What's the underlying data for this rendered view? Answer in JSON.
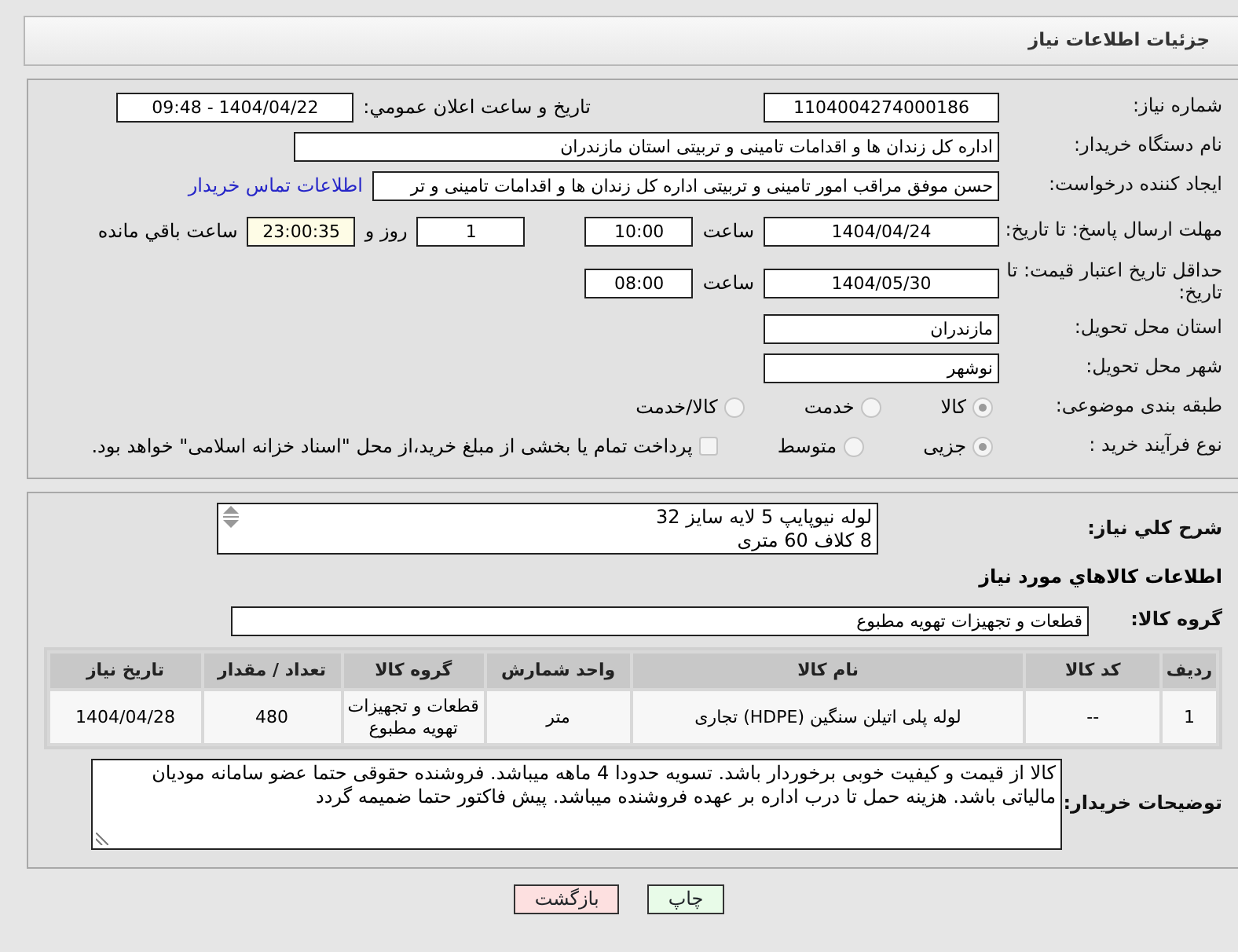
{
  "page_title": "جزئیات اطلاعات نیاز",
  "need_number": {
    "label": "شماره نیاز:",
    "value": "1104004274000186"
  },
  "announce": {
    "label": "تاريخ و ساعت اعلان عمومي:",
    "value": "1404/04/22 - 09:48"
  },
  "buyer_org": {
    "label": "نام دستگاه خریدار:",
    "value": "اداره کل زندان ها و اقدامات تامینی و تربیتی استان مازندران"
  },
  "requester": {
    "label": "ایجاد کننده درخواست:",
    "value": "حسن موفق مراقب امور تامینی و تربیتی اداره کل زندان ها و اقدامات تامینی و تر",
    "contact_link": "اطلاعات تماس خریدار"
  },
  "reply_deadline": {
    "label": "مهلت ارسال پاسخ: تا تاریخ:",
    "date": "1404/04/24",
    "time_label": "ساعت",
    "time": "10:00",
    "days": "1",
    "days_label": "روز و",
    "remaining": "23:00:35",
    "remaining_label": "ساعت باقي مانده"
  },
  "price_validity": {
    "label": "حداقل تاریخ اعتبار قیمت: تا تاریخ:",
    "date": "1404/05/30",
    "time_label": "ساعت",
    "time": "08:00"
  },
  "province": {
    "label": "استان محل تحویل:",
    "value": "مازندران"
  },
  "city": {
    "label": "شهر محل تحویل:",
    "value": "نوشهر"
  },
  "subject_category": {
    "label": "طبقه بندی موضوعی:",
    "options": [
      {
        "label": "کالا",
        "selected": true
      },
      {
        "label": "خدمت",
        "selected": false
      },
      {
        "label": "کالا/خدمت",
        "selected": false
      }
    ]
  },
  "purchase_process": {
    "label": "نوع فرآیند خرید :",
    "options": [
      {
        "label": "جزیی",
        "selected": true
      },
      {
        "label": "متوسط",
        "selected": false
      }
    ],
    "treasury_payment": {
      "label": "پرداخت تمام یا بخشی از مبلغ خرید،از محل \"اسناد خزانه اسلامی\" خواهد بود.",
      "checked": false
    }
  },
  "general_description": {
    "label": "شرح کلي نیاز:",
    "lines": [
      "لوله نیوپایپ 5 لایه سایز 32",
      "8 کلاف 60 متری"
    ]
  },
  "goods_heading": "اطلاعات کالاهاي مورد نياز",
  "goods_group": {
    "label": "گروه کالا:",
    "value": "قطعات و تجهیزات تهویه مطبوع"
  },
  "table": {
    "columns": [
      "ردیف",
      "کد کالا",
      "نام کالا",
      "واحد شمارش",
      "گروه کالا",
      "تعداد / مقدار",
      "تاریخ نیاز"
    ],
    "rows": [
      [
        "1",
        "--",
        "لوله پلی اتیلن سنگین (HDPE) تجاری",
        "متر",
        "قطعات و تجهیزات تهویه مطبوع",
        "480",
        "1404/04/28"
      ]
    ]
  },
  "buyer_notes": {
    "label": "توضیحات خریدار:",
    "text": "کالا از قیمت و کیفیت خوبی برخوردار باشد. تسویه حدودا 4 ماهه میباشد. فروشنده حقوقی حتما عضو سامانه مودیان مالیاتی باشد. هزینه حمل تا درب اداره بر عهده فروشنده میباشد. پیش فاکتور حتما ضمیمه گردد"
  },
  "buttons": [
    {
      "label": "چاپ",
      "kind": "print"
    },
    {
      "label": "بازگشت",
      "kind": "back"
    }
  ]
}
